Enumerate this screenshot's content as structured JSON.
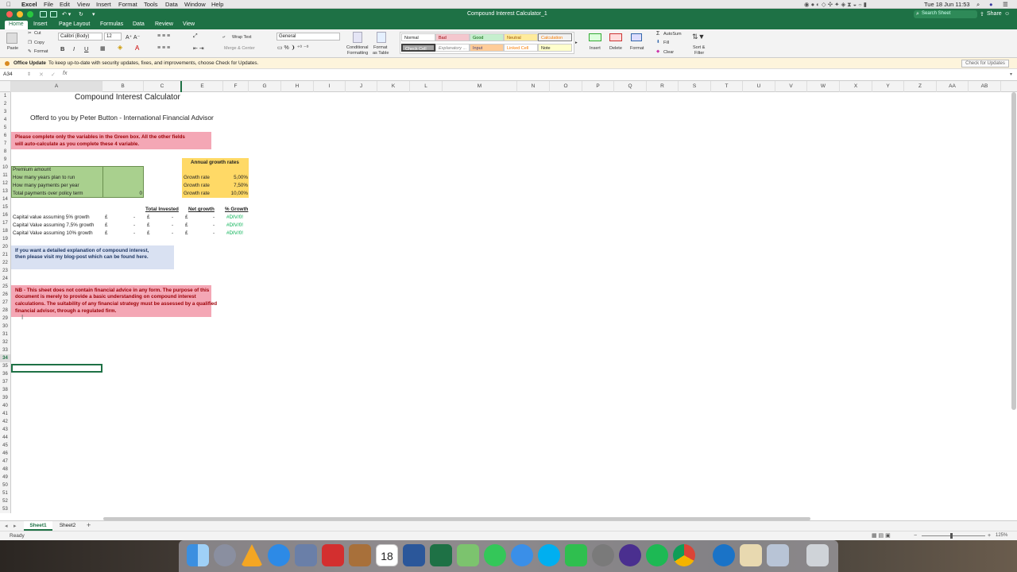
{
  "menubar": {
    "app": "Excel",
    "items": [
      "File",
      "Edit",
      "View",
      "Insert",
      "Format",
      "Tools",
      "Data",
      "Window",
      "Help"
    ],
    "clock": "Tue 18 Jun  11:53"
  },
  "title": {
    "document": "Compound Interest Calculator_1",
    "search_placeholder": "Search Sheet",
    "share": "Share"
  },
  "ribbon_tabs": [
    "Home",
    "Insert",
    "Page Layout",
    "Formulas",
    "Data",
    "Review",
    "View"
  ],
  "ribbon": {
    "paste": "Paste",
    "cut": "Cut",
    "copy": "Copy",
    "format": "Format",
    "font": "Calibri (Body)",
    "size": "12",
    "wrap_text": "Wrap Text",
    "merge_center": "Merge & Center",
    "number_format": "General",
    "conditional": "Conditional",
    "formatting": "Formatting",
    "format_as": "Format",
    "as_table": "as Table",
    "styles": [
      {
        "label": "Normal",
        "bg": "#ffffff",
        "fg": "#222222"
      },
      {
        "label": "Bad",
        "bg": "#f4c7ce",
        "fg": "#9c0006"
      },
      {
        "label": "Good",
        "bg": "#c6efce",
        "fg": "#006100"
      },
      {
        "label": "Neutral",
        "bg": "#ffeb9c",
        "fg": "#9c5700"
      },
      {
        "label": "Calculation",
        "bg": "#f2f2f2",
        "fg": "#fa7d00"
      },
      {
        "label": "Check Cell",
        "bg": "#a5a5a5",
        "fg": "#ffffff"
      },
      {
        "label": "Explanatory ...",
        "bg": "#ffffff",
        "fg": "#7f7f7f"
      },
      {
        "label": "Input",
        "bg": "#ffcc99",
        "fg": "#3f3f76"
      },
      {
        "label": "Linked Cell",
        "bg": "#ffffff",
        "fg": "#fa7d00"
      },
      {
        "label": "Note",
        "bg": "#ffffcc",
        "fg": "#222222"
      }
    ],
    "insert": "Insert",
    "delete": "Delete",
    "format_cells": "Format",
    "autosum": "AutoSum",
    "fill": "Fill",
    "clear": "Clear",
    "sort": "Sort &",
    "filter": "Filter"
  },
  "notify": {
    "title": "Office Update",
    "message": "To keep up-to-date with security updates, fixes, and improvements, choose Check for Updates.",
    "button": "Check for Updates"
  },
  "formula_bar": {
    "name_box": "A34",
    "fx": "fx",
    "value": ""
  },
  "columns": [
    "A",
    "B",
    "C",
    "E",
    "F",
    "G",
    "H",
    "I",
    "J",
    "K",
    "L",
    "M",
    "N",
    "O",
    "P",
    "Q",
    "R",
    "S",
    "T",
    "U",
    "V",
    "W",
    "X",
    "Y",
    "Z",
    "AA",
    "AB"
  ],
  "rows": [
    "1",
    "2",
    "3",
    "4",
    "5",
    "6",
    "7",
    "8",
    "9",
    "10",
    "11",
    "12",
    "13",
    "14",
    "15",
    "16",
    "17",
    "18",
    "19",
    "20",
    "21",
    "22",
    "23",
    "24",
    "25",
    "26",
    "27",
    "28",
    "29",
    "30",
    "31",
    "32",
    "33",
    "34",
    "35",
    "36",
    "37",
    "38",
    "39",
    "40",
    "41",
    "42",
    "43",
    "44",
    "45",
    "46",
    "47",
    "48",
    "49",
    "50",
    "51",
    "52",
    "53"
  ],
  "sheet": {
    "title": "Compound Interest Calculator",
    "subtitle": "Offerd to you by Peter Button - International Financial Advisor",
    "instructions_1": "Please complete only the variables in the Green box.  All the other fields",
    "instructions_2": "will auto-calculate as you complete these 4 variable.",
    "inputs": [
      {
        "label": "Premium amount",
        "value": ""
      },
      {
        "label": "How many years plan to run",
        "value": ""
      },
      {
        "label": "How many payments per year",
        "value": ""
      },
      {
        "label": "Total payments over policy term",
        "value": "0"
      }
    ],
    "growth_header": "Annual growth rates",
    "growth_rates": [
      {
        "label": "Growth rate",
        "value": "5,00%"
      },
      {
        "label": "Growth rate",
        "value": "7,50%"
      },
      {
        "label": "Growth rate",
        "value": "10,00%"
      }
    ],
    "headers": {
      "total_invested": "Total Invested",
      "net_growth": "Net growth",
      "pct_growth": "% Growth"
    },
    "capital_rows": [
      {
        "label": "Capital value assuming 5% growth",
        "b": "£",
        "b2": "-",
        "c": "£",
        "c2": "-",
        "e": "£",
        "e2": "-",
        "f": "#DIV/0!"
      },
      {
        "label": "Capital Value assuming 7,5% growth",
        "b": "£",
        "b2": "-",
        "c": "£",
        "c2": "-",
        "e": "£",
        "e2": "-",
        "f": "#DIV/0!"
      },
      {
        "label": "Capital Value assuming 10% growth",
        "b": "£",
        "b2": "-",
        "c": "£",
        "c2": "-",
        "e": "£",
        "e2": "-",
        "f": "#DIV/0!"
      }
    ],
    "blog_1": "If you want a detailed explanation of compound interest,",
    "blog_2": "then please visit my blog-post which can be found here.",
    "nb_1": "NB - This sheet does not contain financial advice in any form.  The purpose of this",
    "nb_2": "document is merely to provide a basic understanding on  compound interest",
    "nb_3": "calculations.  The suitability of any financial strategy must be assessed by a qualified",
    "nb_4": "financial advisor, through a regulated firm."
  },
  "sheet_tabs": [
    "Sheet1",
    "Sheet2"
  ],
  "status": {
    "ready": "Ready",
    "zoom": "125%"
  },
  "colors": {
    "excel_green": "#1e7145",
    "input_green": "#a9d08e",
    "pink": "#f4a7b5",
    "yellow": "#ffd966",
    "blue": "#d9e1f2",
    "error_green": "#00b050"
  }
}
